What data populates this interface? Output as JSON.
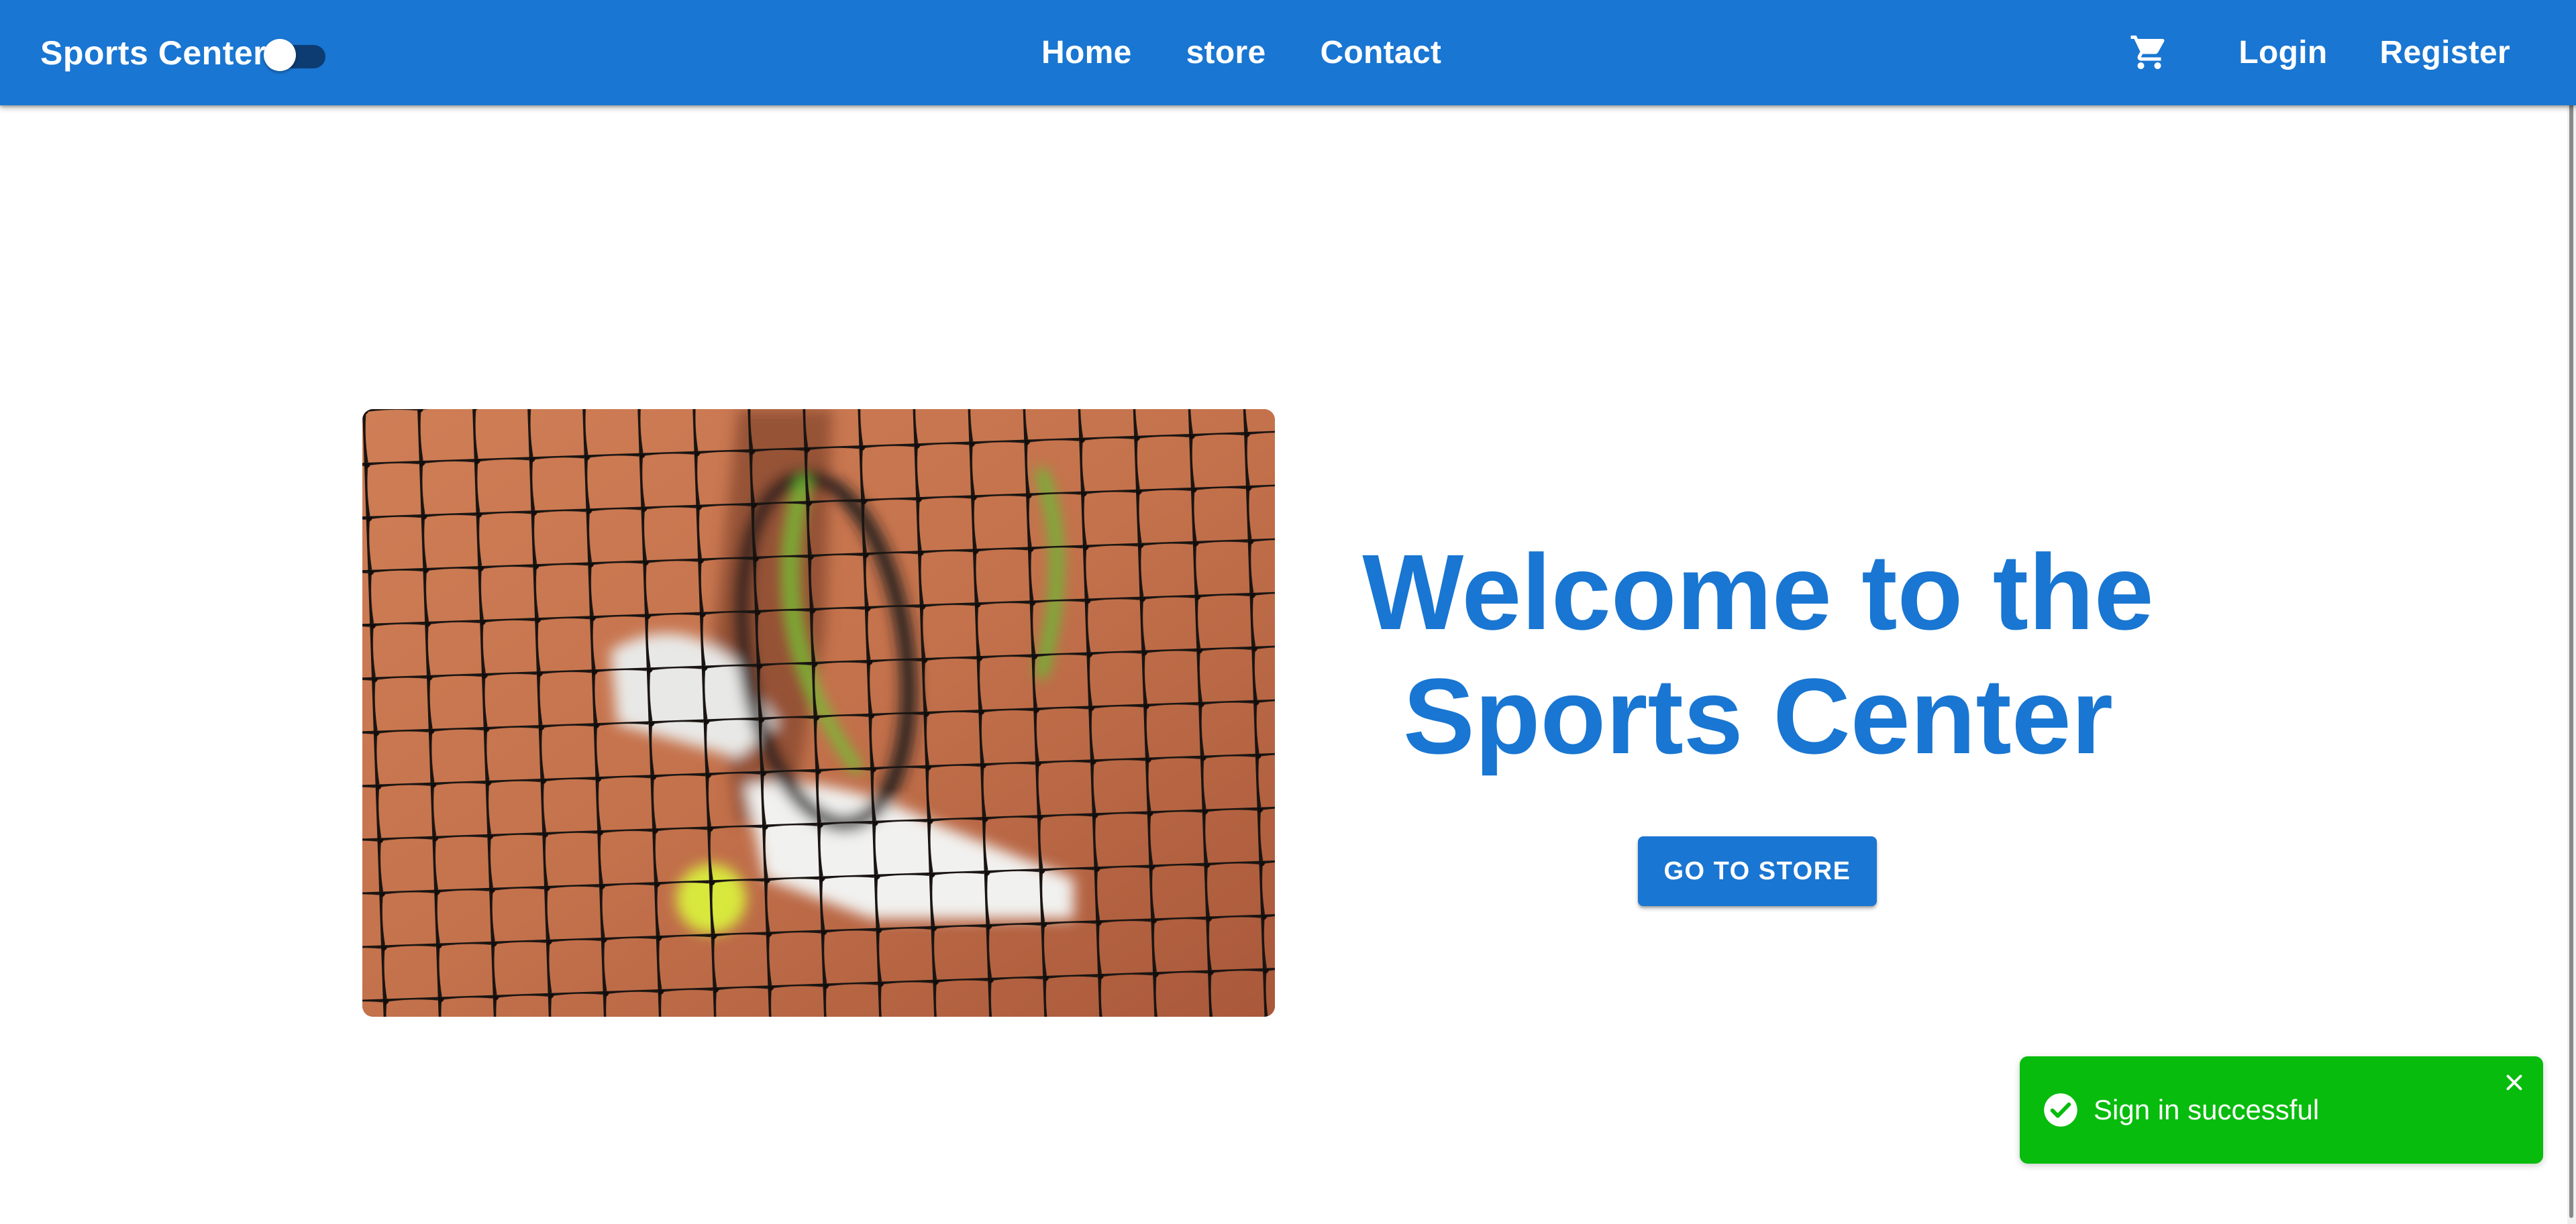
{
  "appbar": {
    "brand": "Sports Center",
    "theme_toggle_on": false,
    "nav_center": [
      "Home",
      "store",
      "Contact"
    ],
    "cart_icon": "shopping-cart-icon",
    "nav_right": [
      "Login",
      "Register"
    ]
  },
  "hero": {
    "image_alt": "tennis-net-racket-ball",
    "title": "Welcome to the Sports Center",
    "button_label": "GO TO STORE"
  },
  "toast": {
    "message": "Sign in successful",
    "icon": "check-circle-icon",
    "close_icon": "close-icon"
  },
  "colors": {
    "primary": "#1976d2",
    "toast_success": "#07bc0c",
    "background": "#ffffff"
  }
}
